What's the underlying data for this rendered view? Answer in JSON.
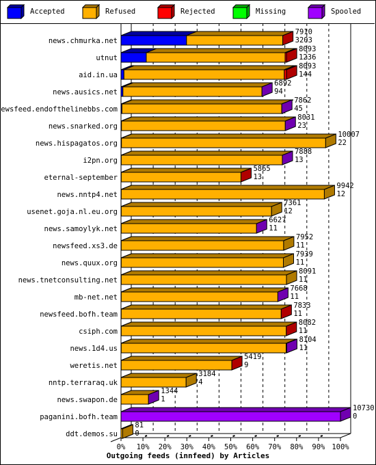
{
  "legend": [
    {
      "name": "Accepted",
      "color": "#0000ff",
      "side": "#0000a0"
    },
    {
      "name": "Refused",
      "color": "#ffb000",
      "side": "#b07a00"
    },
    {
      "name": "Rejected",
      "color": "#ff0000",
      "side": "#b00000"
    },
    {
      "name": "Missing",
      "color": "#00ff00",
      "side": "#00b000"
    },
    {
      "name": "Spooled",
      "color": "#a000ff",
      "side": "#7000b0"
    }
  ],
  "chart_data": {
    "type": "bar",
    "orientation": "horizontal",
    "stacked": true,
    "three_d": true,
    "title": "",
    "xlabel": "Outgoing feeds (innfeed) by Articles",
    "ylabel": "",
    "xlim": [
      0,
      100
    ],
    "x_ticks": [
      "0%",
      "10%",
      "20%",
      "30%",
      "40%",
      "50%",
      "60%",
      "70%",
      "80%",
      "90%",
      "100%"
    ],
    "grid": true,
    "legend_position": "top",
    "max_total": 10730,
    "categories": [
      "news.chmurka.net",
      "utnut",
      "aid.in.ua",
      "news.ausics.net",
      "newsfeed.endofthelinebbs.com",
      "news.snarked.org",
      "news.hispagatos.org",
      "i2pn.org",
      "eternal-september",
      "news.nntp4.net",
      "usenet.goja.nl.eu.org",
      "news.samoylyk.net",
      "newsfeed.xs3.de",
      "news.quux.org",
      "news.tnetconsulting.net",
      "mb-net.net",
      "newsfeed.bofh.team",
      "csiph.com",
      "news.1d4.us",
      "weretis.net",
      "nntp.terraraq.uk",
      "news.swapon.de",
      "paganini.bofh.team",
      "ddt.demos.su"
    ],
    "totals": [
      7910,
      8093,
      8093,
      6892,
      7862,
      8031,
      10007,
      7888,
      5865,
      9942,
      7361,
      6627,
      7952,
      7939,
      8091,
      7668,
      7833,
      8082,
      8104,
      5419,
      3184,
      1344,
      10730,
      81
    ],
    "series": [
      {
        "name": "Accepted",
        "values": [
          3203,
          1236,
          144,
          94,
          45,
          23,
          22,
          13,
          13,
          12,
          12,
          11,
          11,
          11,
          11,
          11,
          11,
          11,
          11,
          9,
          4,
          1,
          0,
          0
        ]
      },
      {
        "name": "Refused",
        "values": [
          4707,
          6787,
          7839,
          6798,
          7817,
          8008,
          9985,
          7875,
          5852,
          9930,
          7349,
          6616,
          7941,
          7928,
          8080,
          7657,
          7822,
          8071,
          8063,
          5410,
          3180,
          1343,
          0,
          81
        ]
      },
      {
        "name": "Rejected",
        "values": [
          0,
          70,
          110,
          0,
          0,
          0,
          0,
          0,
          0,
          0,
          0,
          0,
          0,
          0,
          0,
          0,
          0,
          0,
          0,
          0,
          0,
          0,
          0,
          0
        ]
      },
      {
        "name": "Missing",
        "values": [
          0,
          0,
          0,
          0,
          0,
          0,
          0,
          0,
          0,
          0,
          0,
          0,
          0,
          0,
          0,
          0,
          0,
          0,
          0,
          0,
          0,
          0,
          0,
          0
        ]
      },
      {
        "name": "Spooled",
        "values": [
          0,
          0,
          0,
          0,
          60,
          0,
          0,
          0,
          0,
          0,
          0,
          0,
          0,
          0,
          0,
          0,
          0,
          0,
          30,
          0,
          0,
          0,
          10730,
          0
        ]
      }
    ],
    "end_cap": [
      "Rejected",
      "Rejected",
      "Rejected",
      "Spooled",
      "Spooled",
      "Spooled",
      "Refused",
      "Spooled",
      "Rejected",
      "Refused",
      "Refused",
      "Spooled",
      "Refused",
      "Refused",
      "Refused",
      "Spooled",
      "Rejected",
      "Rejected",
      "Spooled",
      "Rejected",
      "Refused",
      "Spooled",
      "Spooled",
      "Refused"
    ]
  }
}
